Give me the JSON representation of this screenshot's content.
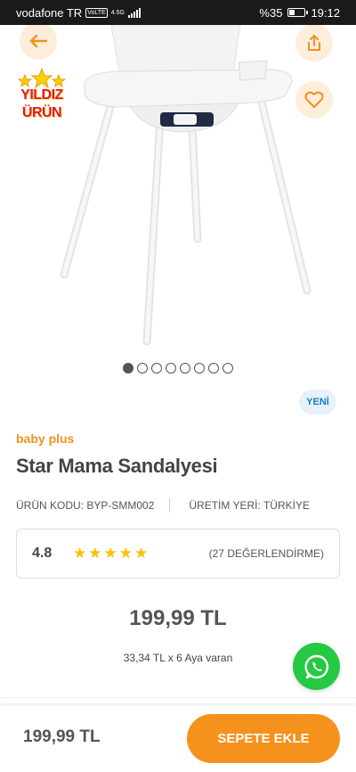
{
  "status_bar": {
    "carrier": "vodafone TR",
    "volte": "VoLTE",
    "network": "4.5G",
    "battery_percent": "%35",
    "battery_level": 0.35,
    "time": "19:12"
  },
  "gallery": {
    "badge_line1": "YILDIZ",
    "badge_line2": "ÜRÜN",
    "image_count": 8,
    "active_index": 0
  },
  "product": {
    "new_badge": "YENİ",
    "brand": "baby plus",
    "title": "Star Mama Sandalyesi",
    "code_label": "ÜRÜN KODU: BYP-SMM002",
    "origin_label": "ÜRETİM YERİ: TÜRKİYE",
    "rating": "4.8",
    "stars": 5,
    "reviews": "(27 DEĞERLENDİRME)",
    "price": "199,99 TL",
    "installment": "33,34 TL x 6 Aya varan"
  },
  "bottom_bar": {
    "price": "199,99 TL",
    "cart_button": "SEPETE EKLE"
  },
  "colors": {
    "accent": "#f5921d",
    "brand": "#f2911b",
    "star": "#f7c200",
    "whatsapp": "#26c943",
    "new_badge_bg": "#e6f2fb",
    "new_badge_text": "#1a7ac4"
  }
}
